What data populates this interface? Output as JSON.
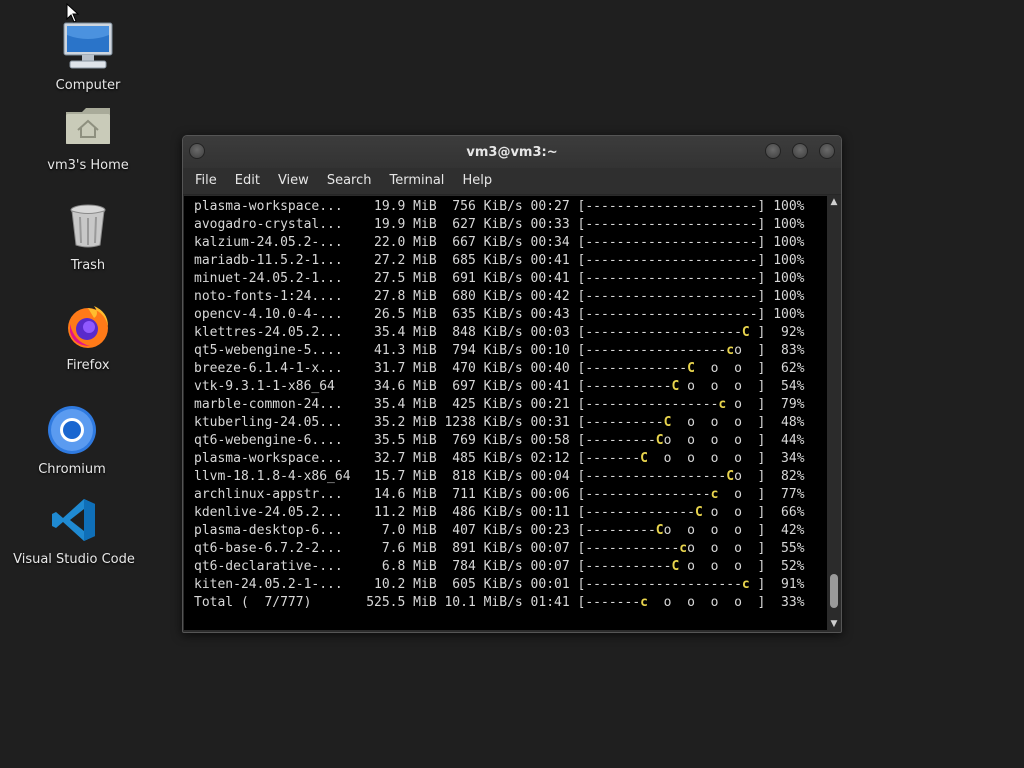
{
  "desktop": {
    "icons": [
      {
        "label": "Computer",
        "icon": "computer-icon"
      },
      {
        "label": "vm3's Home",
        "icon": "home-folder-icon"
      },
      {
        "label": "Trash",
        "icon": "trash-icon"
      },
      {
        "label": "Firefox",
        "icon": "firefox-icon"
      },
      {
        "label": "Chromium",
        "icon": "chromium-icon"
      },
      {
        "label": "Visual Studio Code",
        "icon": "vscode-icon"
      }
    ]
  },
  "window": {
    "title": "vm3@vm3:~",
    "menu": [
      "File",
      "Edit",
      "View",
      "Search",
      "Terminal",
      "Help"
    ]
  },
  "terminal": {
    "lines": [
      {
        "name": "plasma-workspace...",
        "size": "19.9 MiB",
        "speed": "756 KiB/s",
        "time": "00:27",
        "bar": "----------------------",
        "pac": "",
        "dots": "",
        "pct": "100%"
      },
      {
        "name": "avogadro-crystal...",
        "size": "19.9 MiB",
        "speed": "627 KiB/s",
        "time": "00:33",
        "bar": "----------------------",
        "pac": "",
        "dots": "",
        "pct": "100%"
      },
      {
        "name": "kalzium-24.05.2-...",
        "size": "22.0 MiB",
        "speed": "667 KiB/s",
        "time": "00:34",
        "bar": "----------------------",
        "pac": "",
        "dots": "",
        "pct": "100%"
      },
      {
        "name": "mariadb-11.5.2-1...",
        "size": "27.2 MiB",
        "speed": "685 KiB/s",
        "time": "00:41",
        "bar": "----------------------",
        "pac": "",
        "dots": "",
        "pct": "100%"
      },
      {
        "name": "minuet-24.05.2-1...",
        "size": "27.5 MiB",
        "speed": "691 KiB/s",
        "time": "00:41",
        "bar": "----------------------",
        "pac": "",
        "dots": "",
        "pct": "100%"
      },
      {
        "name": "noto-fonts-1:24....",
        "size": "27.8 MiB",
        "speed": "680 KiB/s",
        "time": "00:42",
        "bar": "----------------------",
        "pac": "",
        "dots": "",
        "pct": "100%"
      },
      {
        "name": "opencv-4.10.0-4-...",
        "size": "26.5 MiB",
        "speed": "635 KiB/s",
        "time": "00:43",
        "bar": "----------------------",
        "pac": "",
        "dots": "",
        "pct": "100%"
      },
      {
        "name": "klettres-24.05.2...",
        "size": "35.4 MiB",
        "speed": "848 KiB/s",
        "time": "00:03",
        "bar": "--------------------",
        "pac": "C",
        "dots": " ",
        "pct": "92%"
      },
      {
        "name": "qt5-webengine-5....",
        "size": "41.3 MiB",
        "speed": "794 KiB/s",
        "time": "00:10",
        "bar": "------------------",
        "pac": "c",
        "dots": "o  ",
        "pct": "83%"
      },
      {
        "name": "breeze-6.1.4-1-x...",
        "size": "31.7 MiB",
        "speed": "470 KiB/s",
        "time": "00:40",
        "bar": "-------------",
        "pac": "C",
        "dots": "  o  o  ",
        "pct": "62%"
      },
      {
        "name": "vtk-9.3.1-1-x86_64",
        "size": "34.6 MiB",
        "speed": "697 KiB/s",
        "time": "00:41",
        "bar": "-----------",
        "pac": "C",
        "dots": " o  o  o  ",
        "pct": "54%"
      },
      {
        "name": "marble-common-24...",
        "size": "35.4 MiB",
        "speed": "425 KiB/s",
        "time": "00:21",
        "bar": "-----------------",
        "pac": "c",
        "dots": " o  ",
        "pct": "79%"
      },
      {
        "name": "ktuberling-24.05...",
        "size": "35.2 MiB",
        "speed": "1238 KiB/s",
        "time": "00:31",
        "bar": "----------",
        "pac": "C",
        "dots": "  o  o  o  ",
        "pct": "48%"
      },
      {
        "name": "qt6-webengine-6....",
        "size": "35.5 MiB",
        "speed": "769 KiB/s",
        "time": "00:58",
        "bar": "---------",
        "pac": "C",
        "dots": "o  o  o  o  ",
        "pct": "44%"
      },
      {
        "name": "plasma-workspace...",
        "size": "32.7 MiB",
        "speed": "485 KiB/s",
        "time": "02:12",
        "bar": "-------",
        "pac": "C",
        "dots": "  o  o  o  o  ",
        "pct": "34%"
      },
      {
        "name": "llvm-18.1.8-4-x86_64",
        "size": "15.7 MiB",
        "speed": "818 KiB/s",
        "time": "00:04",
        "bar": "------------------",
        "pac": "C",
        "dots": "o  ",
        "pct": "82%"
      },
      {
        "name": "archlinux-appstr...",
        "size": "14.6 MiB",
        "speed": "711 KiB/s",
        "time": "00:06",
        "bar": "----------------",
        "pac": "c",
        "dots": "  o  ",
        "pct": "77%"
      },
      {
        "name": "kdenlive-24.05.2...",
        "size": "11.2 MiB",
        "speed": "486 KiB/s",
        "time": "00:11",
        "bar": "--------------",
        "pac": "C",
        "dots": " o  o  ",
        "pct": "66%"
      },
      {
        "name": "plasma-desktop-6...",
        "size": "7.0 MiB",
        "speed": "407 KiB/s",
        "time": "00:23",
        "bar": "---------",
        "pac": "C",
        "dots": "o  o  o  o  ",
        "pct": "42%"
      },
      {
        "name": "qt6-base-6.7.2-2...",
        "size": "7.6 MiB",
        "speed": "891 KiB/s",
        "time": "00:07",
        "bar": "------------",
        "pac": "c",
        "dots": "o  o  o  ",
        "pct": "55%"
      },
      {
        "name": "qt6-declarative-...",
        "size": "6.8 MiB",
        "speed": "784 KiB/s",
        "time": "00:07",
        "bar": "-----------",
        "pac": "C",
        "dots": " o  o  o  ",
        "pct": "52%"
      },
      {
        "name": "kiten-24.05.2-1-...",
        "size": "10.2 MiB",
        "speed": "605 KiB/s",
        "time": "00:01",
        "bar": "--------------------",
        "pac": "c",
        "dots": " ",
        "pct": "91%"
      },
      {
        "name": "Total (  7/777)",
        "size": "525.5 MiB",
        "speed": "10.1 MiB/s",
        "time": "01:41",
        "bar": "-------",
        "pac": "c",
        "dots": "  o  o  o  o  ",
        "pct": "33%"
      }
    ]
  }
}
